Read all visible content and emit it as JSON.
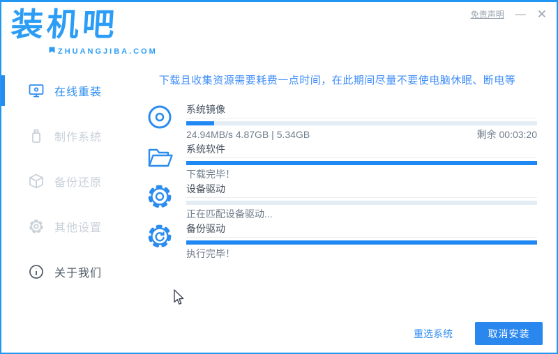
{
  "window": {
    "title_logo": "装机吧",
    "logo_subtitle": "ZHUANGJIBA.COM",
    "border_color": "#2196f3"
  },
  "header": {
    "disclaimer": "免责声明",
    "minimize_glyph": "—",
    "close_glyph": "✕"
  },
  "sidebar": {
    "items": [
      {
        "label": "在线重装",
        "icon": "monitor-icon",
        "state": "active"
      },
      {
        "label": "制作系统",
        "icon": "usb-icon",
        "state": "disabled"
      },
      {
        "label": "备份还原",
        "icon": "box-icon",
        "state": "disabled"
      },
      {
        "label": "其他设置",
        "icon": "gear-icon",
        "state": "disabled"
      },
      {
        "label": "关于我们",
        "icon": "info-icon",
        "state": "normal"
      }
    ]
  },
  "main": {
    "notice": "下载且收集资源需要耗费一点时间，在此期间尽量不要使电脑休眠、断电等",
    "tasks": [
      {
        "name": "系统镜像",
        "icon": "disc-icon",
        "progress": 8,
        "status_left": "24.94MB/s 4.87GB | 5.34GB",
        "status_right": "剩余 00:03:20"
      },
      {
        "name": "系统软件",
        "icon": "folder-icon",
        "progress": 100,
        "status_left": "下载完毕！",
        "status_right": ""
      },
      {
        "name": "设备驱动",
        "icon": "gear-icon",
        "progress": 0,
        "status_left": "正在匹配设备驱动...",
        "status_right": ""
      },
      {
        "name": "备份驱动",
        "icon": "gear-sync-icon",
        "progress": 100,
        "status_left": "执行完毕！",
        "status_right": ""
      }
    ]
  },
  "footer": {
    "reselect_label": "重选系统",
    "cancel_label": "取消安装"
  },
  "colors": {
    "primary_blue": "#2b8cf0",
    "logo_blue": "#2b9df6",
    "progress_fill": "#1f88f2",
    "progress_track": "#e4ecf4",
    "notice_blue": "#3f8df8",
    "label_text": "#43505d",
    "status_text": "#6f7d8c",
    "disabled_gray": "#c9d1d9",
    "button_blue": "#2a87ee"
  }
}
